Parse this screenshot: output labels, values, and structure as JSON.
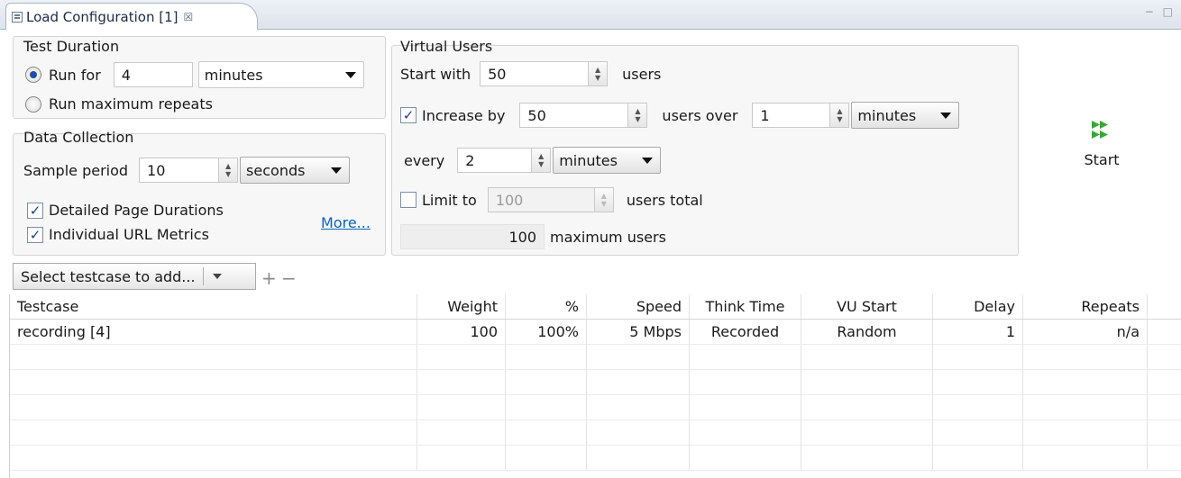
{
  "tab": {
    "title": "Load Configuration [1]",
    "close_glyph": "☒",
    "window_controls": "− □"
  },
  "test_duration": {
    "title": "Test Duration",
    "run_for_label": "Run for",
    "run_for_value": "4",
    "run_for_unit": "minutes",
    "run_max_label": "Run maximum repeats",
    "run_for_selected": true
  },
  "data_collection": {
    "title": "Data Collection",
    "sample_label": "Sample period",
    "sample_value": "10",
    "sample_unit": "seconds",
    "detailed_label": "Detailed Page Durations",
    "url_metrics_label": "Individual URL Metrics",
    "more_link": "More..."
  },
  "virtual_users": {
    "title": "Virtual Users",
    "start_with_label": "Start with",
    "start_with_value": "50",
    "users_label": "users",
    "increase_label": "Increase by",
    "increase_value": "50",
    "users_over_label": "users over",
    "over_value": "1",
    "over_unit": "minutes",
    "every_label": "every",
    "every_value": "2",
    "every_unit": "minutes",
    "limit_label": "Limit to",
    "limit_value": "100",
    "users_total_label": "users total",
    "max_value": "100",
    "max_label": "maximum users"
  },
  "start_button": {
    "label": "Start"
  },
  "toolbar": {
    "select_placeholder": "Select testcase to add...",
    "add_glyph": "+",
    "remove_glyph": "−"
  },
  "table": {
    "headers": [
      "Testcase",
      "Weight",
      "%",
      "Speed",
      "Think Time",
      "VU Start",
      "Delay",
      "Repeats"
    ],
    "rows": [
      [
        "recording [4]",
        "100",
        "100%",
        "5 Mbps",
        "Recorded",
        "Random",
        "1",
        "n/a"
      ]
    ]
  },
  "colors": {
    "accent": "#1f4fa8",
    "link": "#0b63c1",
    "start_icon": "#3aa63a"
  }
}
